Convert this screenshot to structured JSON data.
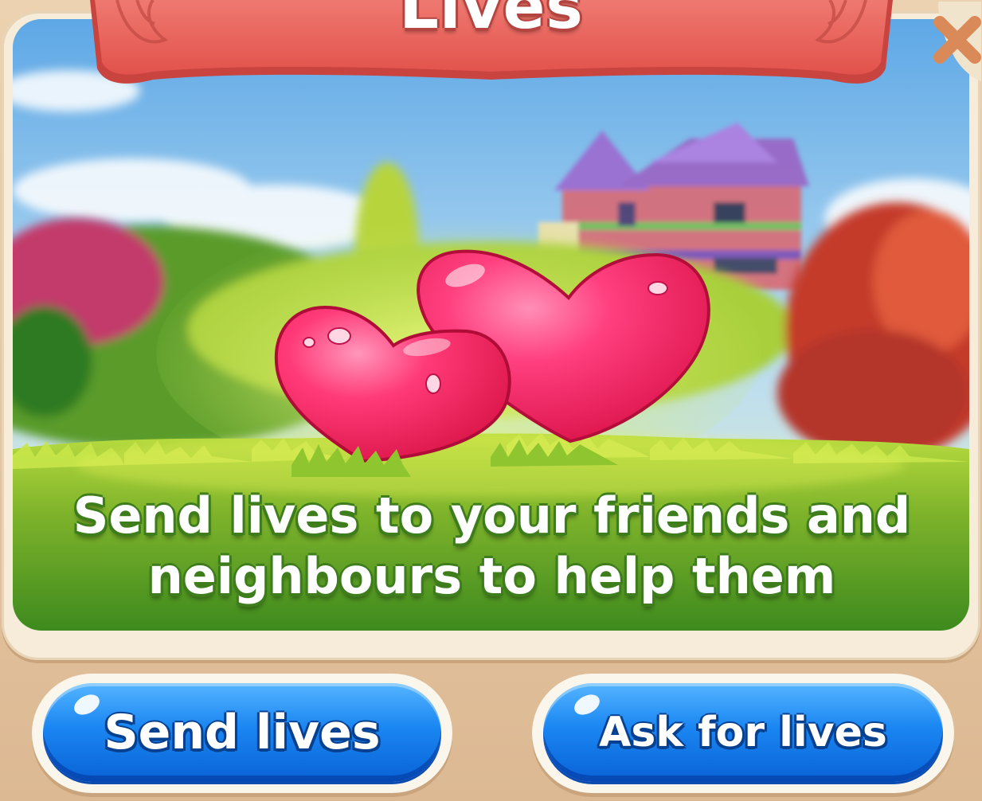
{
  "dialog": {
    "title": "Lives",
    "message": "Send lives to your friends and neighbours to help them",
    "close_icon": "close-x-icon"
  },
  "buttons": {
    "send_label": "Send lives",
    "ask_label": "Ask for lives"
  },
  "colors": {
    "banner": "#ec6a64",
    "button_blue": "#1a86f2",
    "frame": "#f7ecd9",
    "heart": "#f2215f"
  }
}
